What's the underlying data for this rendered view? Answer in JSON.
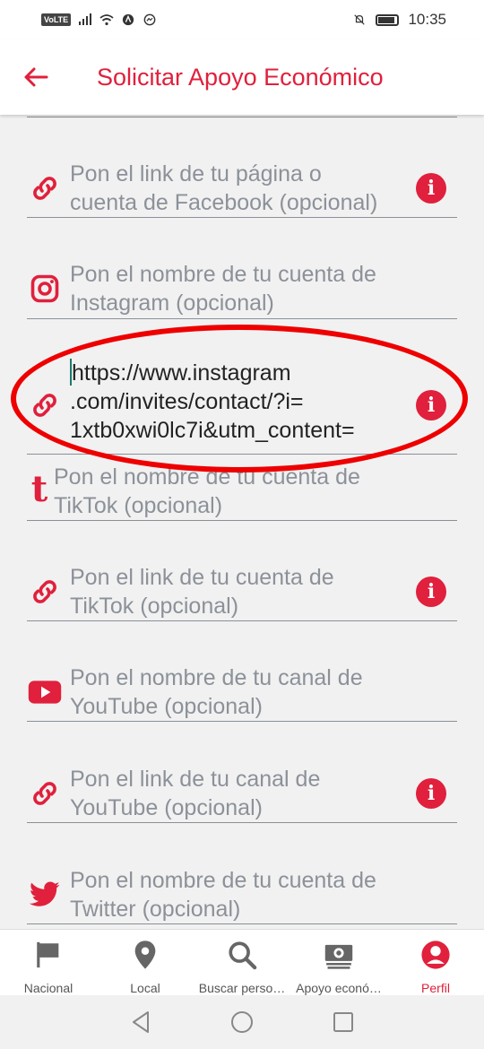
{
  "status_bar": {
    "volte": "VoLTE",
    "time": "10:35"
  },
  "header": {
    "title": "Solicitar Apoyo Económico"
  },
  "fields": [
    {
      "icon": "link-icon",
      "placeholder_line1": "Pon el link de tu página o",
      "placeholder_line2": "cuenta de Facebook (opcional)",
      "has_info": true
    },
    {
      "icon": "instagram-icon",
      "placeholder_line1": "Pon el nombre de tu cuenta de",
      "placeholder_line2": "Instagram (opcional)",
      "has_info": false
    },
    {
      "icon": "link-icon",
      "value_line1": "https://www.instagram",
      "value_line2": ".com/invites/contact/?i=",
      "value_line3": "1xtb0xwi0lc7i&utm_content=",
      "has_info": true
    },
    {
      "icon": "tiktok-t-icon",
      "placeholder_line1": "Pon el nombre de tu cuenta de",
      "placeholder_line2": "TikTok (opcional)",
      "has_info": false
    },
    {
      "icon": "link-icon",
      "placeholder_line1": "Pon el link de tu cuenta de",
      "placeholder_line2": "TikTok (opcional)",
      "has_info": true
    },
    {
      "icon": "youtube-icon",
      "placeholder_line1": "Pon el nombre de tu canal de",
      "placeholder_line2": "YouTube (opcional)",
      "has_info": false
    },
    {
      "icon": "link-icon",
      "placeholder_line1": "Pon el link de tu canal de",
      "placeholder_line2": "YouTube (opcional)",
      "has_info": true
    },
    {
      "icon": "twitter-icon",
      "placeholder_line1": "Pon el nombre de tu cuenta de",
      "placeholder_line2": "Twitter (opcional)",
      "has_info": false
    }
  ],
  "info_glyph": "i",
  "bottom_nav": [
    {
      "label": "Nacional",
      "icon": "flag-icon",
      "active": false
    },
    {
      "label": "Local",
      "icon": "map-pin-icon",
      "active": false
    },
    {
      "label": "Buscar perso…",
      "icon": "search-icon",
      "active": false
    },
    {
      "label": "Apoyo econó…",
      "icon": "money-icon",
      "active": false
    },
    {
      "label": "Perfil",
      "icon": "profile-icon",
      "active": true
    }
  ],
  "colors": {
    "accent": "#e0203c",
    "annotation": "#ee0000",
    "placeholder": "#8c9199",
    "background": "#f1f1f1"
  }
}
